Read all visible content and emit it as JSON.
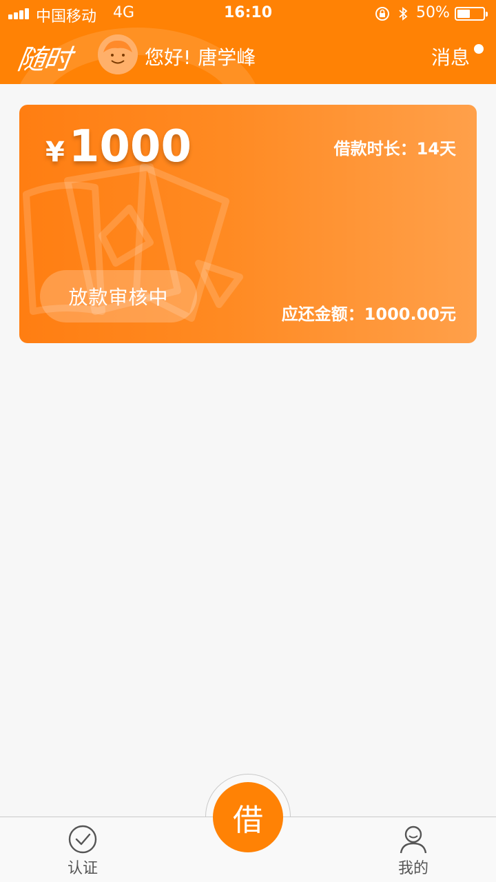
{
  "status_bar": {
    "carrier": "中国移动",
    "network": "4G",
    "time": "16:10",
    "battery_percent_label": "50%",
    "battery_level": 0.5,
    "icons": [
      "signal-icon",
      "rotation-lock-icon",
      "bluetooth-icon",
      "battery-icon"
    ]
  },
  "header": {
    "logo_text": "随时",
    "greeting": "您好!",
    "user_name": "唐学峰",
    "messages_label": "消息",
    "has_unread": true
  },
  "loan_card": {
    "currency_symbol": "¥",
    "amount": "1000",
    "term_label": "借款时长：14天",
    "status_label": "放款审核中",
    "due_label": "应还金额：1000.00元"
  },
  "tabbar": {
    "certify_label": "认证",
    "borrow_label": "借",
    "mine_label": "我的"
  },
  "colors": {
    "brand_orange": "#ff8205",
    "background": "#f7f7f7",
    "tab_text": "#555555"
  }
}
